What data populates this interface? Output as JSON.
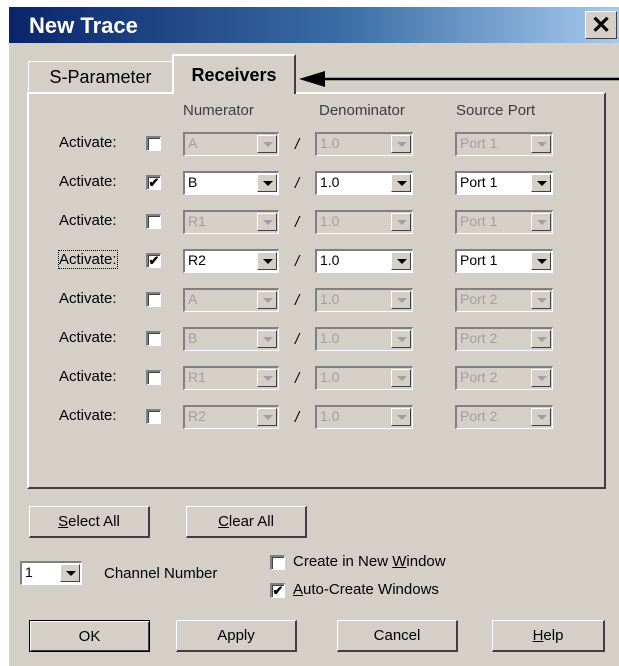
{
  "window": {
    "title": "New Trace",
    "close_label": "✕"
  },
  "tabs": [
    {
      "label": "S-Parameter"
    },
    {
      "label": "Receivers"
    }
  ],
  "columns": {
    "numerator": "Numerator",
    "denominator": "Denominator",
    "source_port": "Source Port"
  },
  "rows": [
    {
      "label": "Activate:",
      "checked": "",
      "numerator": "A",
      "denominator": "1.0",
      "port": "Port 1"
    },
    {
      "label": "Activate:",
      "checked": "✔",
      "numerator": "B",
      "denominator": "1.0",
      "port": "Port 1"
    },
    {
      "label": "Activate:",
      "checked": "",
      "numerator": "R1",
      "denominator": "1.0",
      "port": "Port 1"
    },
    {
      "label": "Activate:",
      "checked": "✔",
      "numerator": "R2",
      "denominator": "1.0",
      "port": "Port 1"
    },
    {
      "label": "Activate:",
      "checked": "",
      "numerator": "A",
      "denominator": "1.0",
      "port": "Port 2"
    },
    {
      "label": "Activate:",
      "checked": "",
      "numerator": "B",
      "denominator": "1.0",
      "port": "Port 2"
    },
    {
      "label": "Activate:",
      "checked": "",
      "numerator": "R1",
      "denominator": "1.0",
      "port": "Port 2"
    },
    {
      "label": "Activate:",
      "checked": "",
      "numerator": "R2",
      "denominator": "1.0",
      "port": "Port 2"
    }
  ],
  "slash": "/",
  "buttons": {
    "select_all": {
      "mnemonic": "S",
      "rest": "elect All"
    },
    "clear_all": {
      "mnemonic": "C",
      "rest": "lear All"
    },
    "ok": "OK",
    "apply": "Apply",
    "cancel": "Cancel",
    "help": {
      "mnemonic": "H",
      "rest": "elp"
    }
  },
  "channel": {
    "value": "1",
    "label": "Channel Number"
  },
  "options": {
    "create_new_window": {
      "before": "Create in New ",
      "mnemonic": "W",
      "after": "indow",
      "checked": ""
    },
    "auto_create": {
      "mnemonic": "A",
      "rest": "uto-Create Windows",
      "checked": "✔"
    }
  },
  "row_enabled": [
    false,
    true,
    false,
    true,
    false,
    false,
    false,
    false
  ]
}
